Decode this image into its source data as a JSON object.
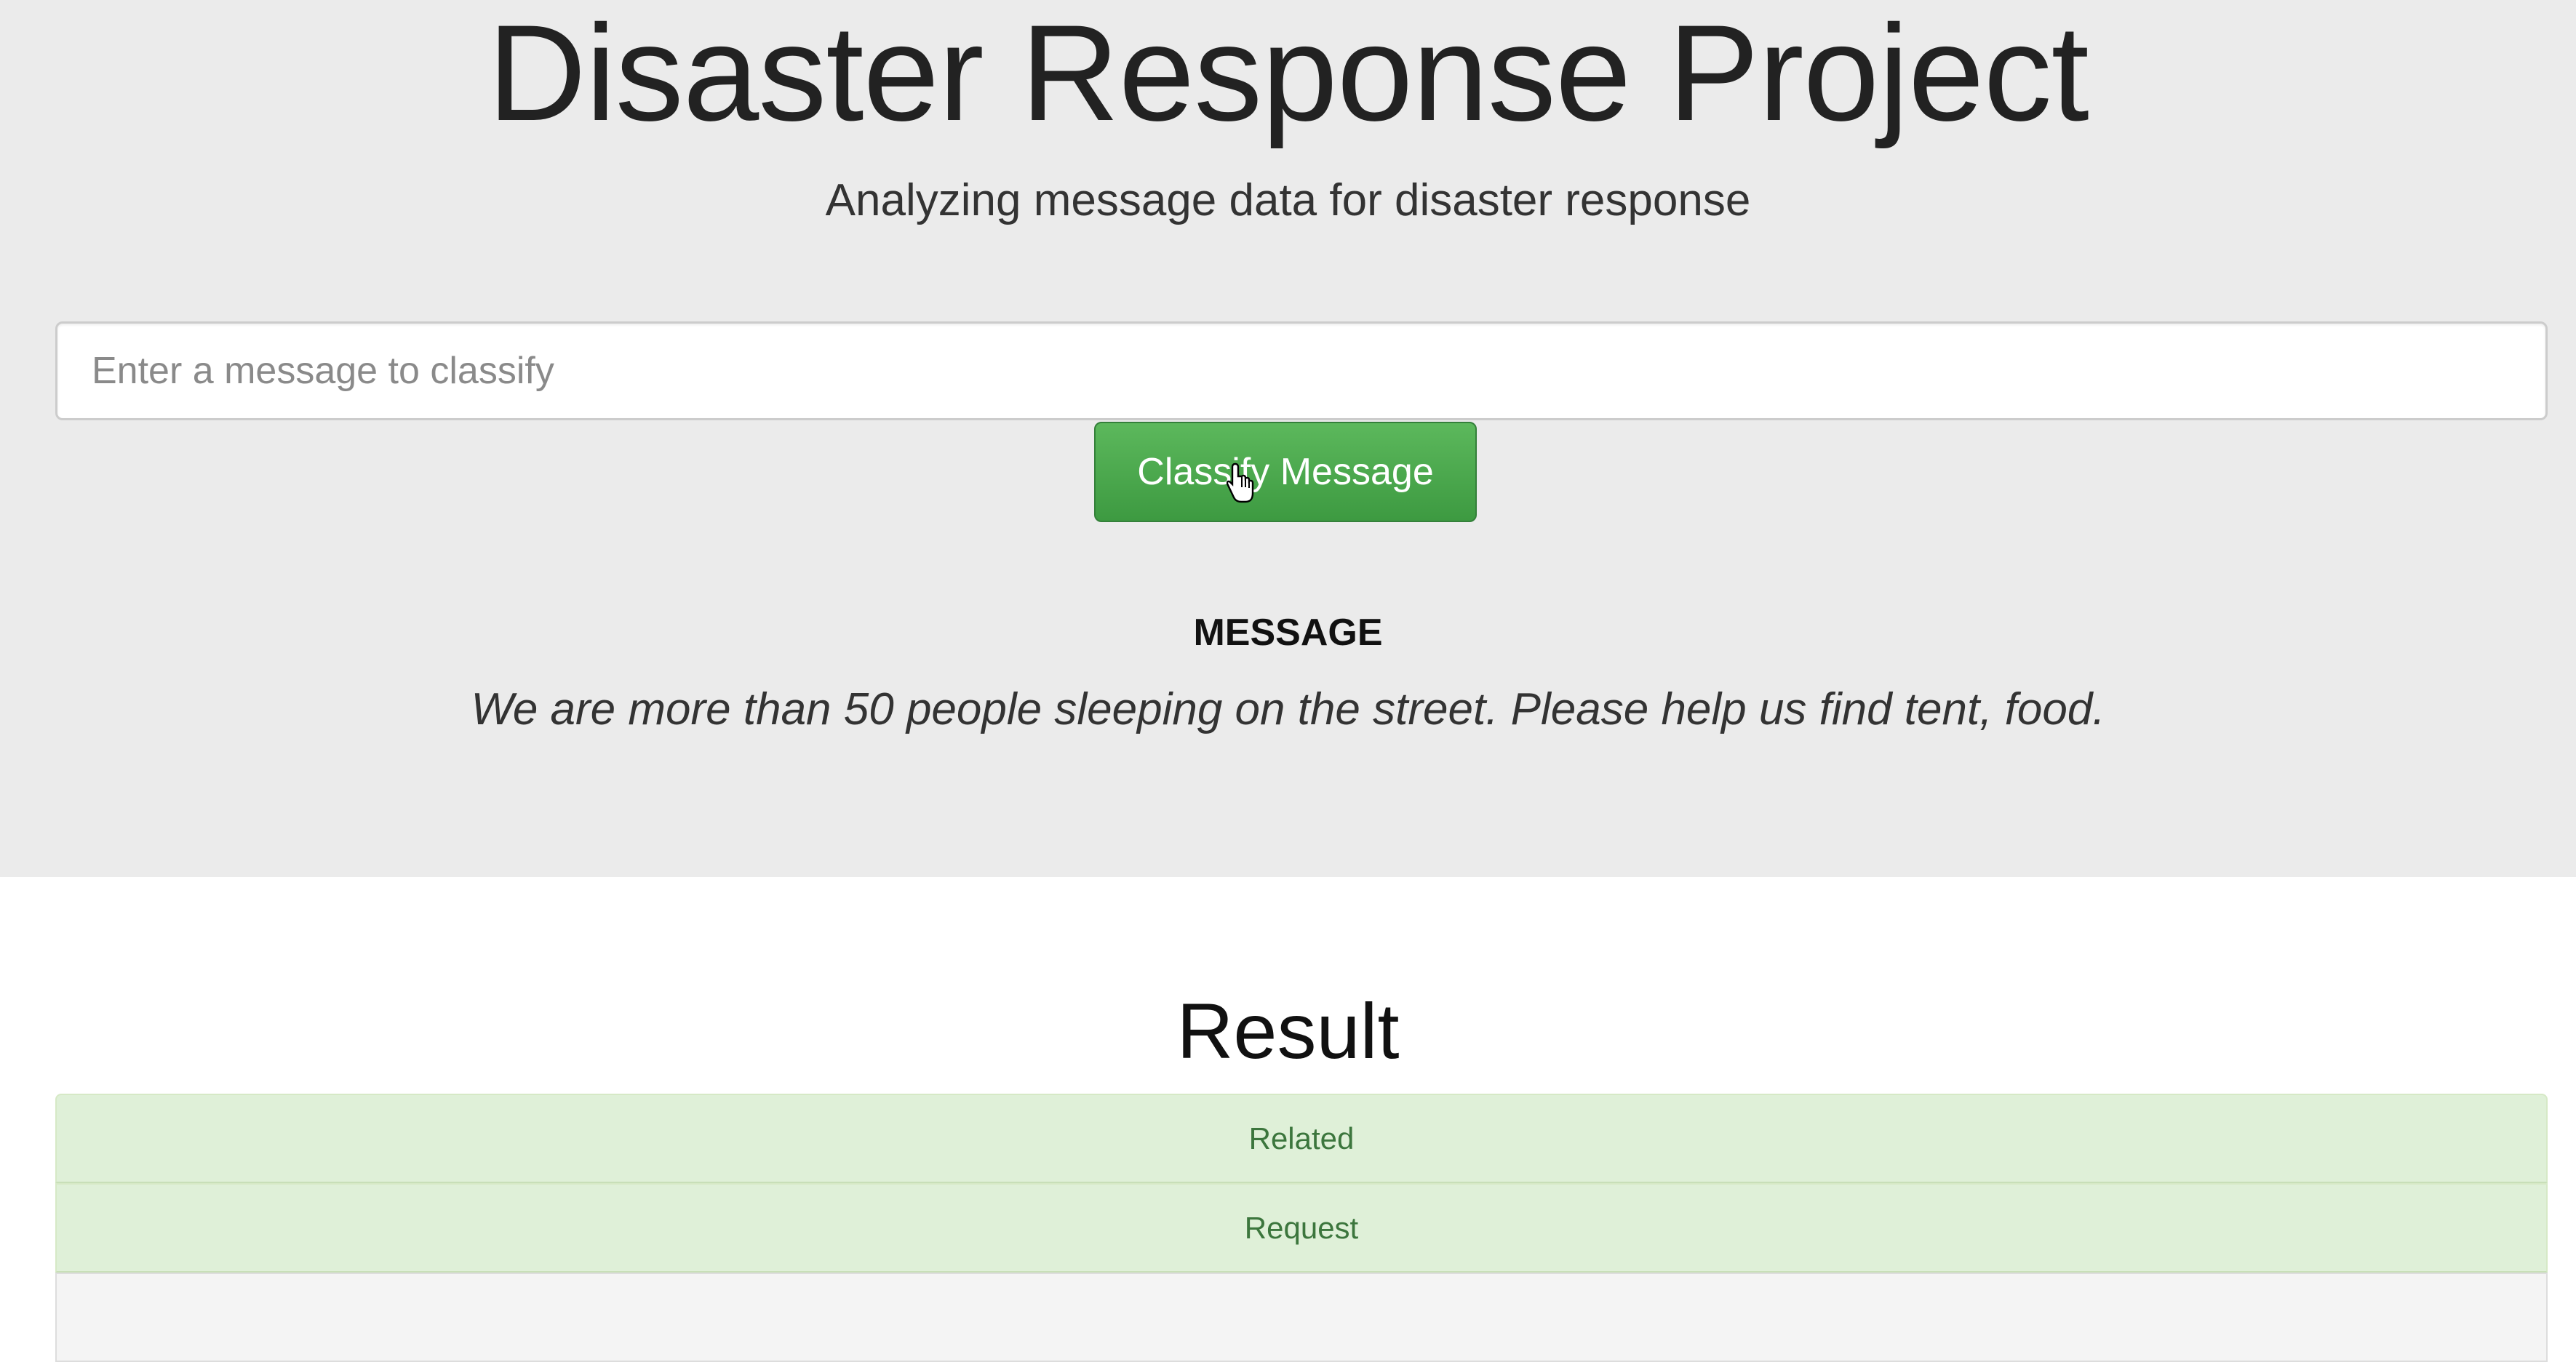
{
  "header": {
    "title": "Disaster Response Project",
    "subtitle": "Analyzing message data for disaster response"
  },
  "form": {
    "input_placeholder": "Enter a message to classify",
    "input_value": "",
    "submit_label": "Classify Message"
  },
  "message": {
    "label": "MESSAGE",
    "text": "We are more than 50 people sleeping on the street. Please help us find tent, food."
  },
  "result": {
    "title": "Result",
    "categories": [
      {
        "label": "Related",
        "state": "positive"
      },
      {
        "label": "Request",
        "state": "positive"
      },
      {
        "label": "",
        "state": "negative"
      }
    ]
  },
  "colors": {
    "jumbotron_bg": "#ebebeb",
    "button_green": "#4cae4c",
    "positive_row_bg": "#dff0d8",
    "positive_row_text": "#3c763d"
  },
  "icons": {
    "cursor": "hand-pointer-icon"
  }
}
